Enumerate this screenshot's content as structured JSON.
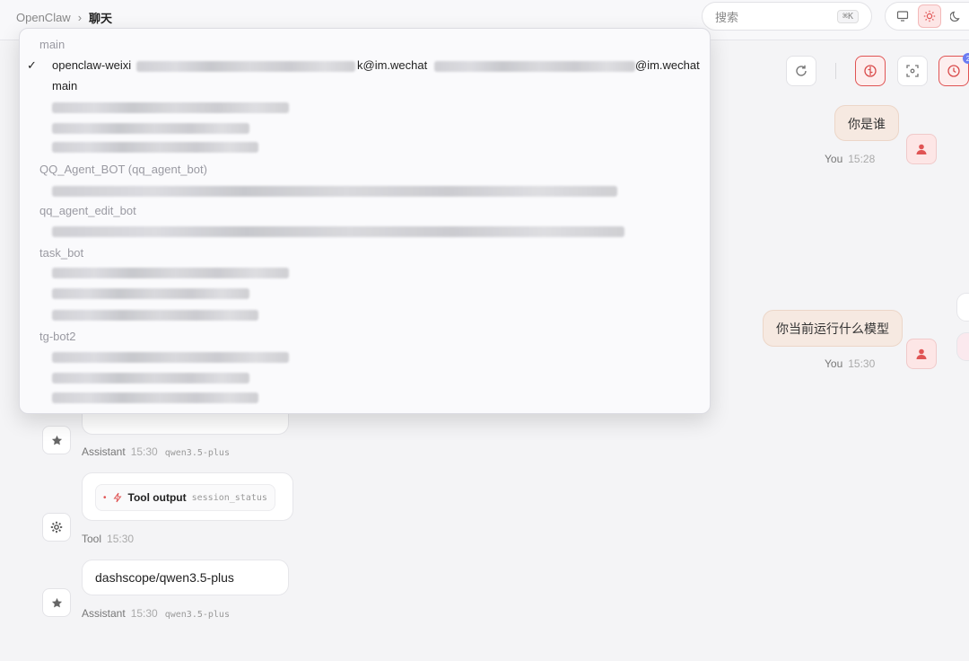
{
  "breadcrumb": {
    "root": "OpenClaw",
    "separator": "›",
    "current": "聊天"
  },
  "search": {
    "placeholder": "搜索",
    "shortcut": "⌘K"
  },
  "theme": {
    "options": [
      "monitor-icon",
      "sun-icon",
      "moon-icon"
    ],
    "active": "sun-icon"
  },
  "toolbar": {
    "buttons": [
      "refresh-icon",
      "brain-icon",
      "focus-icon",
      "clock-icon"
    ],
    "clock_badge": "2"
  },
  "accent": "#e05454",
  "messages": {
    "user1": {
      "text": "你是谁",
      "sender": "You",
      "time": "15:28"
    },
    "user2": {
      "text": "你当前运行什么模型",
      "sender": "You",
      "time": "15:30"
    },
    "assistant1": {
      "sender": "Assistant",
      "time": "15:30",
      "model": "qwen3.5-plus"
    },
    "tool1": {
      "label": "Tool output",
      "code": "session_status",
      "sender": "Tool",
      "time": "15:30"
    },
    "assistant2": {
      "text": "dashscope/qwen3.5-plus",
      "sender": "Assistant",
      "time": "15:30",
      "model": "qwen3.5-plus"
    }
  },
  "session_dropdown": {
    "groups": [
      {
        "label": "main",
        "items": [
          {
            "prefix": "openclaw-weixi",
            "mid": "k@im.wechat",
            "suffix": "@im.wechat",
            "selected": true
          },
          {
            "text": "main"
          }
        ]
      },
      {
        "label": "QQ_Agent_BOT (qq_agent_bot)"
      },
      {
        "label": "qq_agent_edit_bot"
      },
      {
        "label": "task_bot"
      },
      {
        "label": "tg-bot2"
      }
    ],
    "check": "✓"
  }
}
